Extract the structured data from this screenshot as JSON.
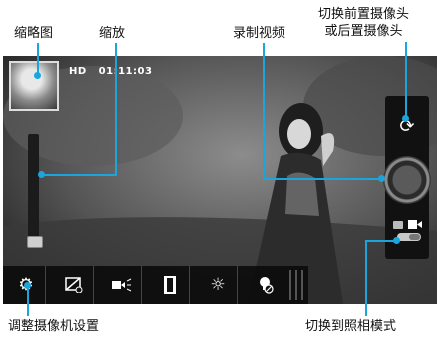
{
  "labels": {
    "thumbnail": "缩略图",
    "zoom": "缩放",
    "record_video": "录制视频",
    "switch_camera_line1": "切换前置摄像头",
    "switch_camera_line2": "或后置摄像头",
    "adjust_settings": "调整摄像机设置",
    "switch_to_photo": "切换到照相模式"
  },
  "screen": {
    "quality": "HD",
    "timer": "01:11:03"
  },
  "toolbar_icons": [
    "gear-icon",
    "exposure-icon",
    "video-effect-icon",
    "filmstrip-icon",
    "brightness-icon",
    "flash-off-icon"
  ],
  "colors": {
    "accent": "#1aa6dc"
  }
}
